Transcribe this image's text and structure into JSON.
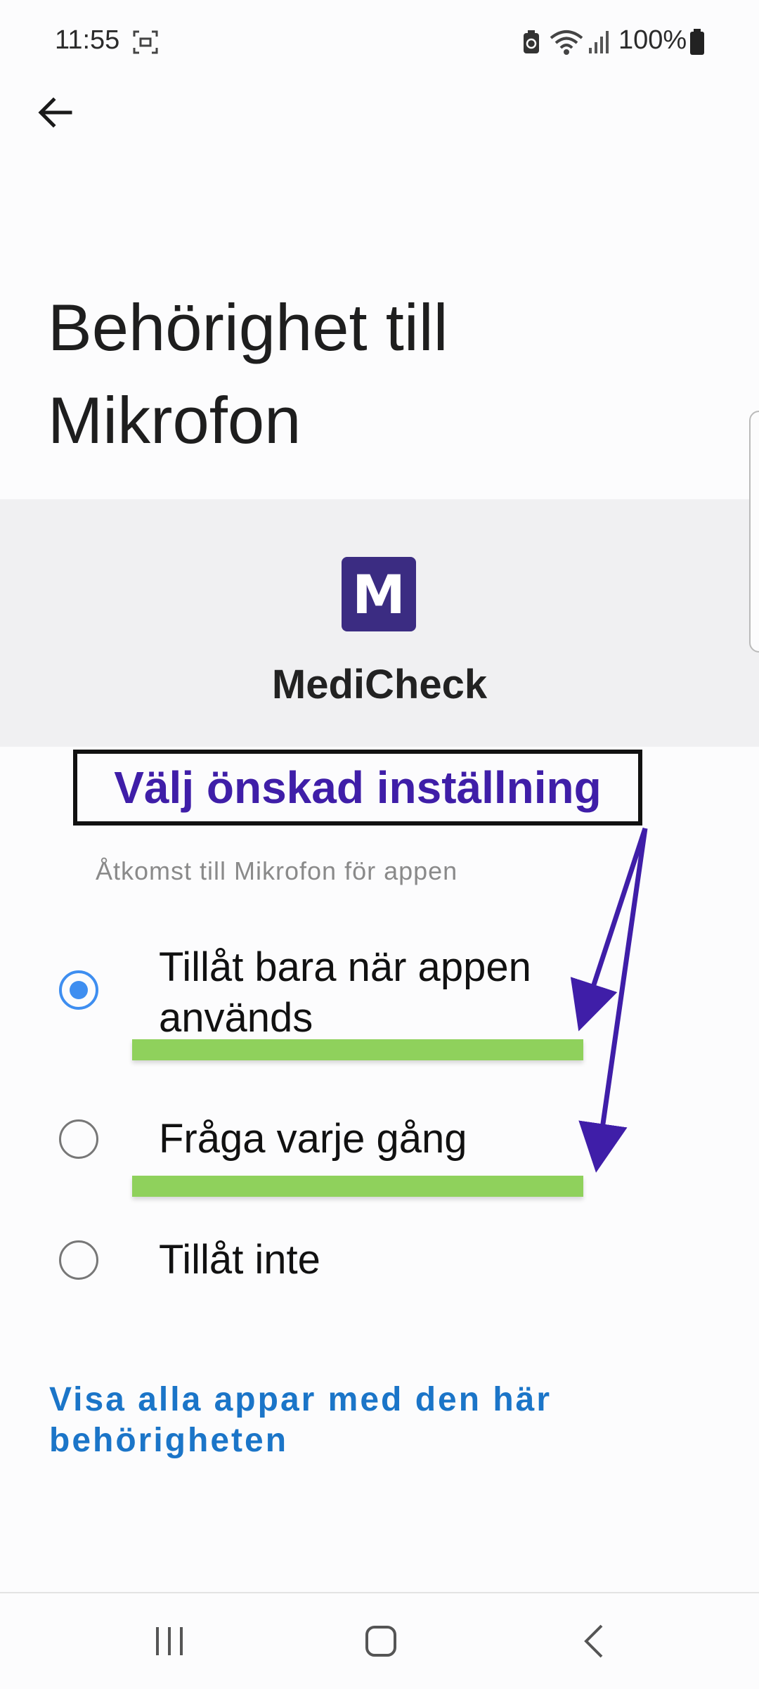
{
  "status_bar": {
    "time": "11:55",
    "battery_percent": "100%",
    "icons": [
      "screenshot-icon",
      "battery-saver-icon",
      "wifi-icon",
      "signal-icon",
      "battery-icon"
    ]
  },
  "header": {
    "back_icon": "arrow-left-icon",
    "title": "Behörighet till Mikrofon"
  },
  "app": {
    "icon_letter": "M",
    "icon_color": "#3b2c82",
    "name": "MediCheck"
  },
  "annotation": {
    "text": "Välj önskad inställning",
    "color": "#3f1ea8",
    "highlight_color": "#8fd15c"
  },
  "permission": {
    "section_label": "Åtkomst till Mikrofon för appen",
    "options": [
      {
        "label_line1": "Tillåt bara när appen",
        "label_line2": "används",
        "selected": true
      },
      {
        "label": "Fråga varje gång",
        "selected": false
      },
      {
        "label": "Tillåt inte",
        "selected": false
      }
    ],
    "accent_color": "#3e8ef0"
  },
  "link": {
    "line1": "Visa alla appar med den här",
    "line2": "behörigheten"
  },
  "nav_bar": {
    "icons": [
      "recent-apps-icon",
      "home-icon",
      "back-icon"
    ]
  }
}
